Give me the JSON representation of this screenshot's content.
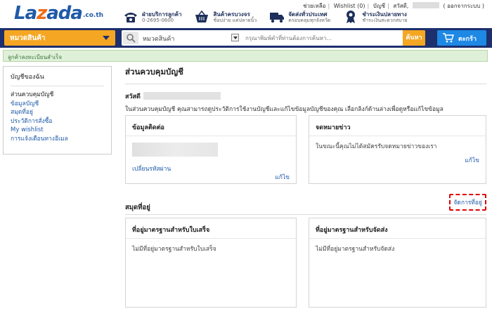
{
  "logo": {
    "main_a": "La",
    "main_z": "z",
    "main_b": "ada",
    "suffix": ".co.th"
  },
  "toplinks": {
    "help": "ช่วยเหลือ",
    "wishlist": "Wishlist (0)",
    "account": "บัญชี",
    "hello": "สวัสดี,",
    "logout": "( ออกจากระบบ )"
  },
  "services": [
    {
      "icon": "phone-icon",
      "line1": "ฝ่ายบริการลูกค้า",
      "line2": "0-2695-0600"
    },
    {
      "icon": "basket-icon",
      "line1": "สินค้าครบวงจร",
      "line2": "ช้อปง่าย แค่ปลายนิ้ว"
    },
    {
      "icon": "truck-icon",
      "line1": "จัดส่งทั่วประเทศ",
      "line2": "ครอบคลุมทุกจังหวัด"
    },
    {
      "icon": "badge-icon",
      "line1": "ชำระเงินปลายทาง",
      "line2": "ชำระเงินสะดวกสบาย"
    }
  ],
  "nav": {
    "category_button": "หมวดสินค้า",
    "search_category": "หมวดสินค้า",
    "search_placeholder": "กรุณาพิมพ์คำที่ท่านต้องการค้นหา...",
    "search_button": "ค้นหา",
    "cart_button": "ตะกร้า"
  },
  "success_message": "ลูกค้าลงทะเบียนสำเร็จ",
  "sidebar": {
    "title": "บัญชีของฉัน",
    "items": [
      "ส่วนควบคุมบัญชี",
      "ข้อมูลบัญชี",
      "สมุดที่อยู่",
      "ประวัติการสั่งซื้อ",
      "My wishlist",
      "การแจ้งเตือนทางอีเมล"
    ]
  },
  "main": {
    "title": "ส่วนควบคุมบัญชี",
    "hello": "สวัสดี",
    "intro": "ในส่วนควบคุมบัญชี คุณสามารถดูประวัติการใช้งานบัญชีและแก้ไขข้อมูลบัญชีของคุณ เลือกลิงก์ด้านล่างเพื่อดูหรือแก้ไขข้อมูล",
    "contact_card": {
      "title": "ข้อมูลติดต่อ",
      "change_password": "เปลี่ยนรหัสผ่าน",
      "edit": "แก้ไข"
    },
    "newsletter_card": {
      "title": "จดหมายข่าว",
      "text": "ในขณะนี้คุณไม่ได้สมัครรับจดหมายข่าวของเรา",
      "edit": "แก้ไข"
    },
    "address_book": {
      "title": "สมุดที่อยู่",
      "manage": "จัดการที่อยู่",
      "billing": {
        "title": "ที่อยู่มาตรฐานสำหรับใบเสร็จ",
        "text": "ไม่มีที่อยู่มาตรฐานสำหรับใบเสร็จ"
      },
      "shipping": {
        "title": "ที่อยู่มาตรฐานสำหรับจัดส่ง",
        "text": "ไม่มีที่อยู่มาตรฐานสำหรับจัดส่ง"
      }
    }
  }
}
